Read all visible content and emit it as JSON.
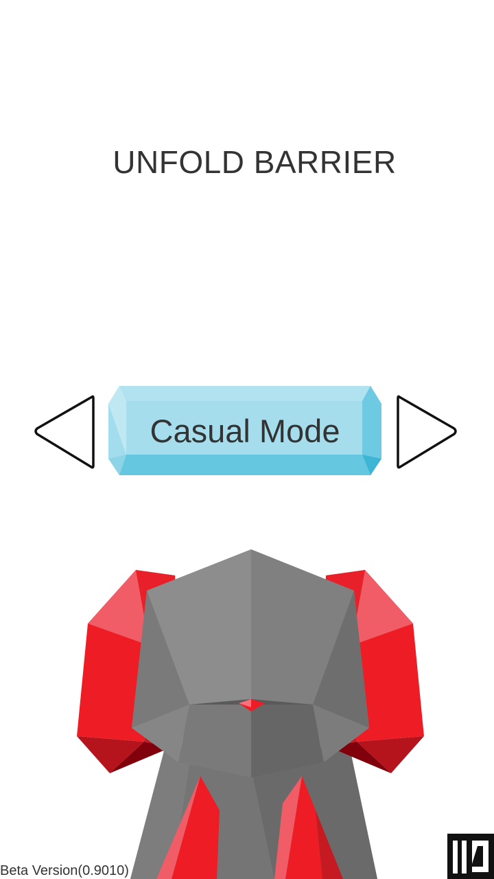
{
  "game": {
    "title": "UNFOLD BARRIER",
    "mode": {
      "label": "Casual Mode"
    },
    "navigation": {
      "prev_icon": "triangle-left-icon",
      "next_icon": "triangle-right-icon"
    },
    "version": "Beta Version(0.9010)",
    "logo_icon": "studio-logo-icon"
  },
  "colors": {
    "text": "#333333",
    "button_light": "#aadfee",
    "button_dark": "#5fc6e0",
    "crystal_red": "#ee1c25",
    "body_gray": "#8c8c8c"
  }
}
